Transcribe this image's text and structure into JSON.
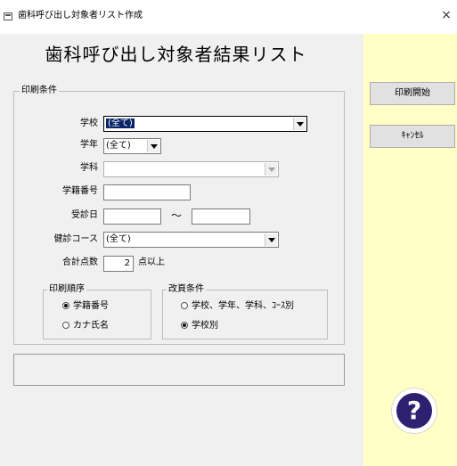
{
  "window": {
    "title": "歯科呼び出し対象者リスト作成",
    "close_glyph": "×"
  },
  "page_title": "歯科呼び出し対象者結果リスト",
  "conditions": {
    "legend": "印刷条件",
    "school": {
      "label": "学校",
      "value": "(全て)"
    },
    "grade": {
      "label": "学年",
      "value": "(全て)"
    },
    "department": {
      "label": "学科",
      "value": ""
    },
    "student_no": {
      "label": "学籍番号",
      "value": ""
    },
    "exam_date": {
      "label": "受診日",
      "from": "",
      "separator": "～",
      "to": ""
    },
    "course": {
      "label": "健診コース",
      "value": "(全て)"
    },
    "score": {
      "label": "合計点数",
      "value": "2",
      "suffix": "点以上"
    }
  },
  "print_order": {
    "legend": "印刷順序",
    "options": [
      {
        "label": "学籍番号",
        "checked": true
      },
      {
        "label": "カナ氏名",
        "checked": false
      }
    ]
  },
  "page_break": {
    "legend": "改頁条件",
    "options": [
      {
        "label": "学校、学年、学科、ｺｰｽ別",
        "checked": false
      },
      {
        "label": "学校別",
        "checked": true
      }
    ]
  },
  "status_text": "",
  "buttons": {
    "print": "印刷開始",
    "cancel": "ｷｬﾝｾﾙ"
  },
  "help_glyph": "?",
  "colors": {
    "side_panel": "#ffffc6",
    "selection": "#0a246a",
    "help": "#2e2070"
  },
  "icons": [
    "app-window-icon",
    "close-icon",
    "dropdown-arrow-icon",
    "help-icon"
  ]
}
